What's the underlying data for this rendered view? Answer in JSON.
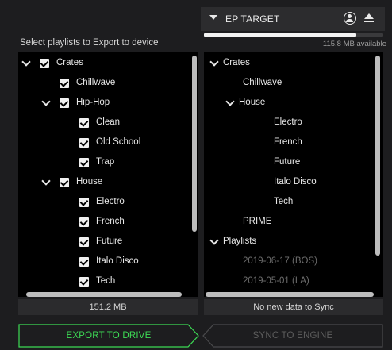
{
  "left": {
    "title": "Select playlists to Export to device",
    "footer": "151.2 MB",
    "tree": [
      {
        "label": "Crates",
        "depth": 0,
        "caret": true,
        "checked": true
      },
      {
        "label": "Chillwave",
        "depth": 1,
        "caret": false,
        "checked": true
      },
      {
        "label": "Hip-Hop",
        "depth": 1,
        "caret": true,
        "checked": true
      },
      {
        "label": "Clean",
        "depth": 2,
        "caret": false,
        "checked": true
      },
      {
        "label": "Old School",
        "depth": 2,
        "caret": false,
        "checked": true
      },
      {
        "label": "Trap",
        "depth": 2,
        "caret": false,
        "checked": true
      },
      {
        "label": "House",
        "depth": 1,
        "caret": true,
        "checked": true
      },
      {
        "label": "Electro",
        "depth": 2,
        "caret": false,
        "checked": true
      },
      {
        "label": "French",
        "depth": 2,
        "caret": false,
        "checked": true
      },
      {
        "label": "Future",
        "depth": 2,
        "caret": false,
        "checked": true
      },
      {
        "label": "Italo Disco",
        "depth": 2,
        "caret": false,
        "checked": true
      },
      {
        "label": "Tech",
        "depth": 2,
        "caret": false,
        "checked": true
      }
    ]
  },
  "device": {
    "name": "EP TARGET",
    "storage_text": "115.8 MB available",
    "storage_used_fraction": 0.85,
    "profile_icon": "profile-icon",
    "eject_icon": "eject-icon",
    "tree": [
      {
        "label": "Crates",
        "depth": 0,
        "caret": true,
        "dim": false
      },
      {
        "label": "Chillwave",
        "depth": 1,
        "caret": false,
        "dim": false
      },
      {
        "label": "House",
        "depth": 1,
        "caret": true,
        "dim": false
      },
      {
        "label": "Electro",
        "depth": 2,
        "caret": false,
        "dim": false
      },
      {
        "label": "French",
        "depth": 2,
        "caret": false,
        "dim": false
      },
      {
        "label": "Future",
        "depth": 2,
        "caret": false,
        "dim": false
      },
      {
        "label": "Italo Disco",
        "depth": 2,
        "caret": false,
        "dim": false
      },
      {
        "label": "Tech",
        "depth": 2,
        "caret": false,
        "dim": false
      },
      {
        "label": "PRIME",
        "depth": 1,
        "caret": false,
        "dim": false
      },
      {
        "label": "Playlists",
        "depth": 0,
        "caret": true,
        "dim": false
      },
      {
        "label": "2019-06-17 (BOS)",
        "depth": 1,
        "caret": false,
        "dim": true
      },
      {
        "label": "2019-05-01 (LA)",
        "depth": 1,
        "caret": false,
        "dim": true
      }
    ],
    "footer": "No new data to Sync"
  },
  "buttons": {
    "export": "EXPORT TO DRIVE",
    "sync": "SYNC TO ENGINE"
  },
  "colors": {
    "accent_green": "#3ddc55",
    "disabled_gray": "#5e5e5e"
  }
}
